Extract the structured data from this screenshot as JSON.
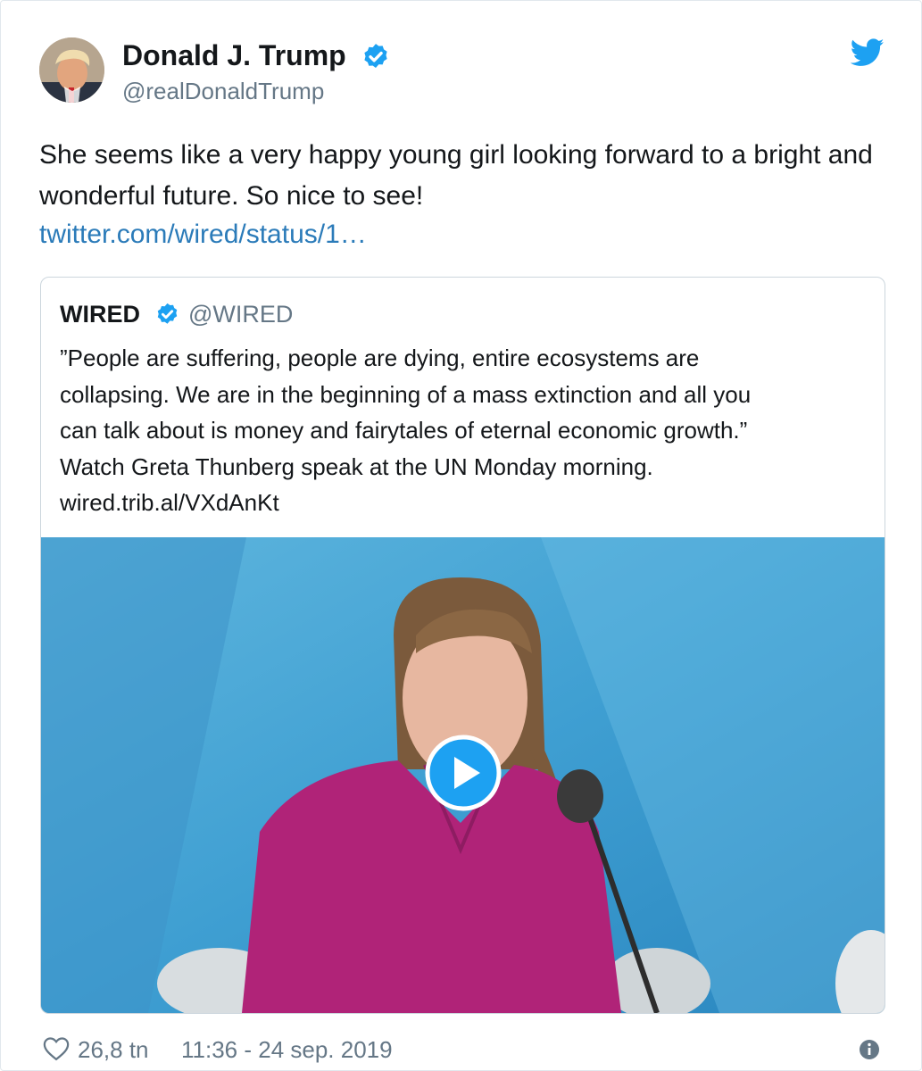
{
  "tweet": {
    "author_name": "Donald J. Trump",
    "author_handle": "@realDonaldTrump",
    "text": "She seems like a very happy young girl looking forward to a bright and wonderful future. So nice to see!",
    "link": "twitter.com/wired/status/1…",
    "likes": "26,8 tn",
    "timestamp": "11:36 - 24 sep. 2019"
  },
  "quoted_tweet": {
    "author_name": "WIRED",
    "author_handle": "@WIRED",
    "text_lines": [
      "”People are suffering, people are dying, entire ecosystems are",
      "collapsing. We are in the beginning of a mass extinction and all you",
      "can talk about is money and fairytales of eternal economic growth.”",
      "Watch Greta Thunberg speak at the UN Monday morning.",
      "wired.trib.al/VXdAnKt"
    ]
  },
  "icons": {
    "verified": "verified-badge-icon",
    "brand": "twitter-bird-icon",
    "like": "heart-icon",
    "info": "info-icon",
    "play": "play-icon"
  },
  "colors": {
    "brand_blue": "#1da1f2",
    "link_blue": "#2b7bb9",
    "text_primary": "#14171a",
    "text_secondary": "#657786",
    "border": "#e1e8ed"
  }
}
